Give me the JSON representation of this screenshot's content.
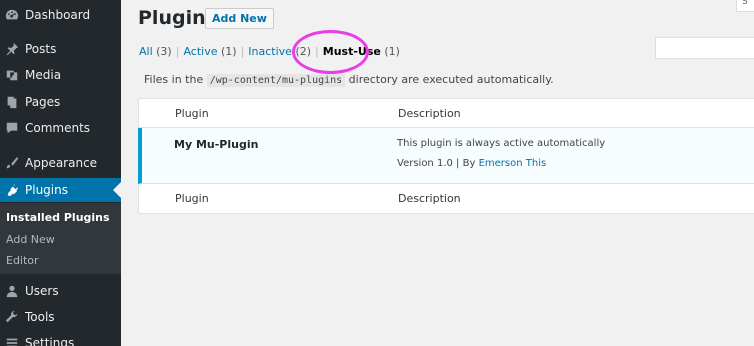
{
  "sidebar": {
    "items": [
      {
        "label": "Dashboard",
        "icon": "dashboard-icon"
      },
      {
        "label": "Posts",
        "icon": "pushpin-icon"
      },
      {
        "label": "Media",
        "icon": "media-icon"
      },
      {
        "label": "Pages",
        "icon": "pages-icon"
      },
      {
        "label": "Comments",
        "icon": "comment-icon"
      },
      {
        "label": "Appearance",
        "icon": "paintbrush-icon"
      },
      {
        "label": "Plugins",
        "icon": "plugin-icon"
      },
      {
        "label": "Users",
        "icon": "users-icon"
      },
      {
        "label": "Tools",
        "icon": "wrench-icon"
      },
      {
        "label": "Settings",
        "icon": "settings-icon"
      }
    ],
    "submenu": [
      "Installed Plugins",
      "Add New",
      "Editor"
    ]
  },
  "header": {
    "title": "Plugins",
    "add_new": "Add New",
    "screen_options": "S"
  },
  "filters": {
    "all": {
      "label": "All",
      "count": "(3)"
    },
    "active": {
      "label": "Active",
      "count": "(1)"
    },
    "inactive": {
      "label": "Inactive",
      "count": "(2)"
    },
    "must_use": {
      "label": "Must-Use",
      "count": "(1)"
    },
    "separator": "|"
  },
  "notice": {
    "prefix": "Files in the",
    "path": "/wp-content/mu-plugins",
    "suffix": "directory are executed automatically."
  },
  "table": {
    "columns": [
      "Plugin",
      "Description"
    ],
    "rows": [
      {
        "name": "My Mu-Plugin",
        "description": "This plugin is always active automatically",
        "version": "Version 1.0",
        "separator": "|",
        "by": "By",
        "author": "Emerson This"
      }
    ]
  },
  "colors": {
    "sidebar_bg": "#23282d",
    "active_blue": "#0073aa",
    "row_accent": "#00a0d2",
    "annotation_circle": "#e83ee8"
  }
}
